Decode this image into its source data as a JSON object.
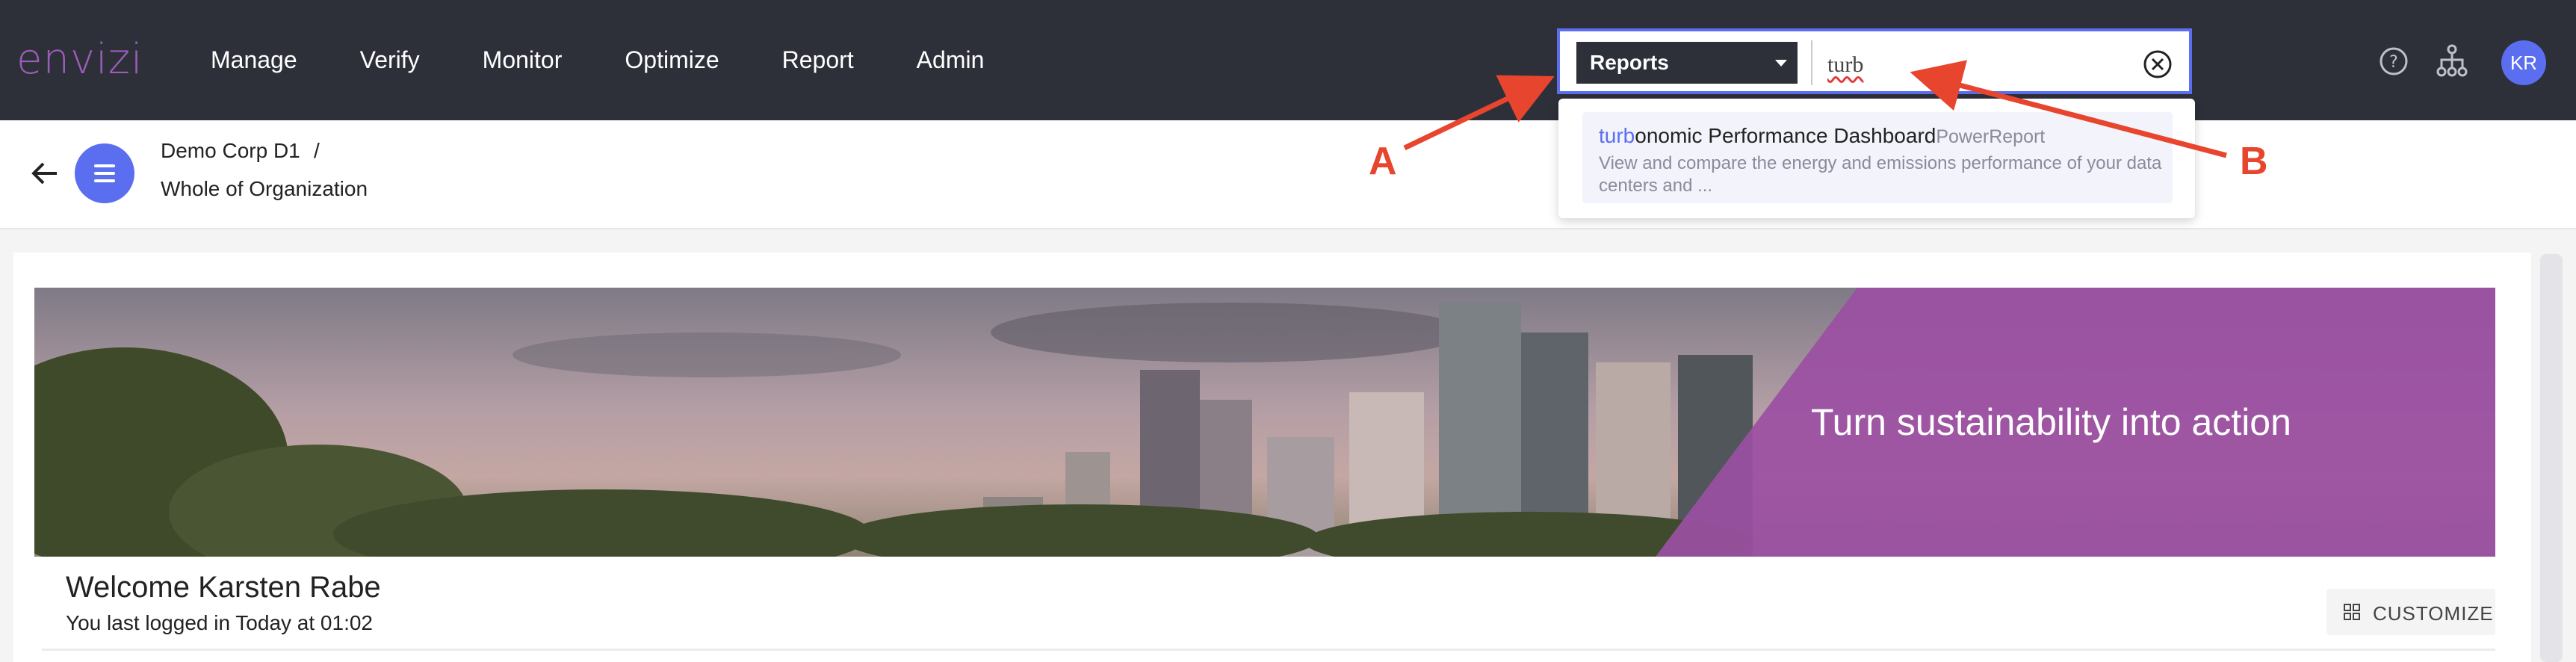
{
  "app": {
    "logo_text": "envizi"
  },
  "nav": {
    "items": [
      "Manage",
      "Verify",
      "Monitor",
      "Optimize",
      "Report",
      "Admin"
    ]
  },
  "search": {
    "scope_label": "Reports",
    "query": "turb"
  },
  "header_icons": [
    "help-icon",
    "org-hierarchy-icon"
  ],
  "user": {
    "initials": "KR"
  },
  "breadcrumb": {
    "org": "Demo Corp D1",
    "separator": "/",
    "location": "Whole of Organization"
  },
  "search_results": [
    {
      "title_match": "turb",
      "title_rest": "onomic Performance Dashboard",
      "type": "PowerReport",
      "description": "View and compare the energy and emissions performance of your data centers and ..."
    }
  ],
  "banner": {
    "tagline": "Turn sustainability into action"
  },
  "welcome": {
    "title": "Welcome Karsten Rabe",
    "last_login": "You last logged in Today at 01:02"
  },
  "customize": {
    "label": "CUSTOMIZE"
  },
  "annotations": {
    "a": "A",
    "b": "B"
  },
  "colors": {
    "topbar": "#2e3039",
    "accent": "#5b6ef0",
    "logo": "#9b5db8",
    "banner_overlay": "#9b4fa3",
    "annotation": "#e8452e"
  }
}
